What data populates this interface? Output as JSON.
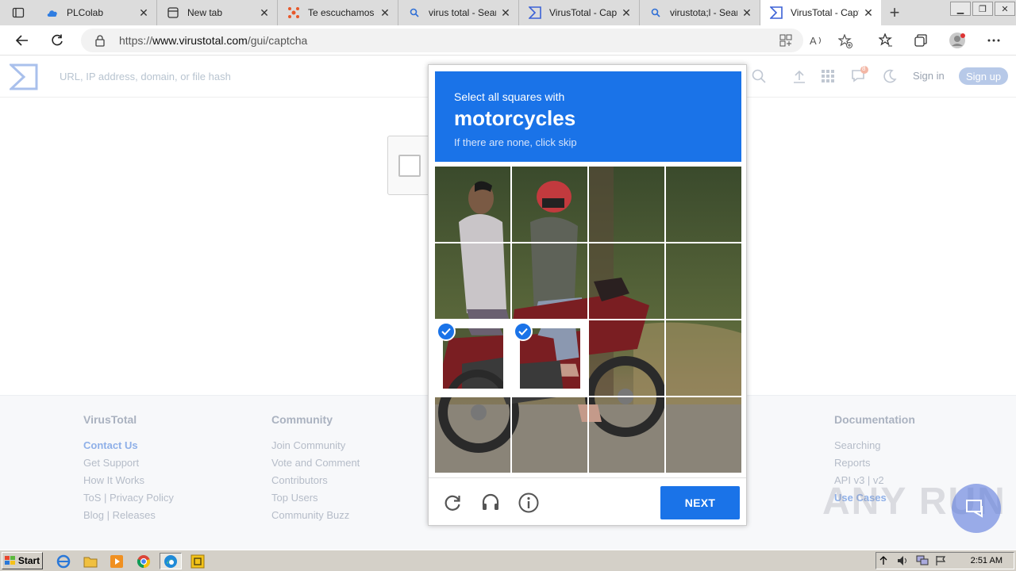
{
  "browser": {
    "tabs": [
      {
        "title": "PLColab",
        "icon": "cloud-icon"
      },
      {
        "title": "New tab",
        "icon": "newtab-icon"
      },
      {
        "title": "Te escuchamos (",
        "icon": "survey-icon"
      },
      {
        "title": "virus total - Sear",
        "icon": "search-icon"
      },
      {
        "title": "VirusTotal - Capt",
        "icon": "virustotal-icon"
      },
      {
        "title": "virustota;l - Sear",
        "icon": "search-icon"
      },
      {
        "title": "VirusTotal - Capt",
        "icon": "virustotal-icon"
      }
    ],
    "url_prefix": "https://",
    "url_domain": "www.virustotal.com",
    "url_path": "/gui/captcha"
  },
  "vt": {
    "search_placeholder": "URL, IP address, domain, or file hash",
    "notification_count": "8",
    "signin": "Sign in",
    "signup": "Sign up",
    "accent": "#b7c9e8"
  },
  "footer": {
    "col1": {
      "title": "VirusTotal",
      "links": [
        "Contact Us",
        "Get Support",
        "How It Works",
        "ToS | Privacy Policy",
        "Blog | Releases"
      ]
    },
    "col2": {
      "title": "Community",
      "links": [
        "Join Community",
        "Vote and Comment",
        "Contributors",
        "Top Users",
        "Community Buzz"
      ]
    },
    "col3": {
      "title": "Documentation",
      "links": [
        "Searching",
        "Reports",
        "API v3 | v2",
        "Use Cases"
      ]
    }
  },
  "captcha": {
    "prompt_prefix": "Select all squares with",
    "target_object": "motorcycles",
    "prompt_hint": "If there are none, click skip",
    "next_button": "NEXT",
    "brand_color": "#1a73e8",
    "selected_tiles": [
      [
        2,
        0
      ],
      [
        2,
        1
      ]
    ]
  },
  "watermark": {
    "text": "ANY RUN"
  },
  "taskbar": {
    "start": "Start",
    "clock": "2:51 AM"
  }
}
